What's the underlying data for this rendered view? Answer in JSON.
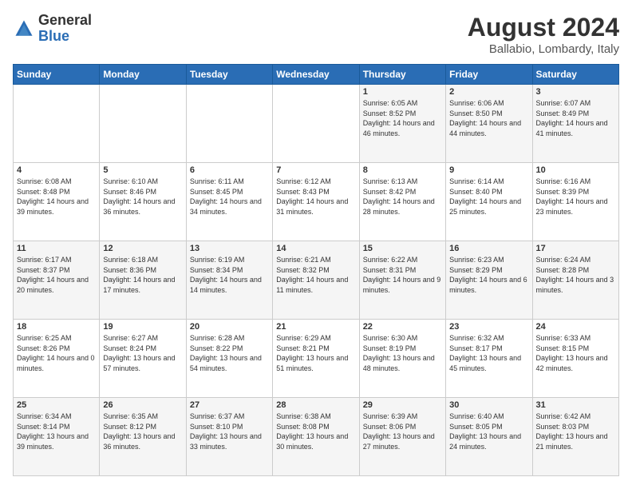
{
  "header": {
    "logo_general": "General",
    "logo_blue": "Blue",
    "main_title": "August 2024",
    "subtitle": "Ballabio, Lombardy, Italy"
  },
  "calendar": {
    "days_of_week": [
      "Sunday",
      "Monday",
      "Tuesday",
      "Wednesday",
      "Thursday",
      "Friday",
      "Saturday"
    ],
    "weeks": [
      [
        {
          "day": "",
          "info": ""
        },
        {
          "day": "",
          "info": ""
        },
        {
          "day": "",
          "info": ""
        },
        {
          "day": "",
          "info": ""
        },
        {
          "day": "1",
          "info": "Sunrise: 6:05 AM\nSunset: 8:52 PM\nDaylight: 14 hours and 46 minutes."
        },
        {
          "day": "2",
          "info": "Sunrise: 6:06 AM\nSunset: 8:50 PM\nDaylight: 14 hours and 44 minutes."
        },
        {
          "day": "3",
          "info": "Sunrise: 6:07 AM\nSunset: 8:49 PM\nDaylight: 14 hours and 41 minutes."
        }
      ],
      [
        {
          "day": "4",
          "info": "Sunrise: 6:08 AM\nSunset: 8:48 PM\nDaylight: 14 hours and 39 minutes."
        },
        {
          "day": "5",
          "info": "Sunrise: 6:10 AM\nSunset: 8:46 PM\nDaylight: 14 hours and 36 minutes."
        },
        {
          "day": "6",
          "info": "Sunrise: 6:11 AM\nSunset: 8:45 PM\nDaylight: 14 hours and 34 minutes."
        },
        {
          "day": "7",
          "info": "Sunrise: 6:12 AM\nSunset: 8:43 PM\nDaylight: 14 hours and 31 minutes."
        },
        {
          "day": "8",
          "info": "Sunrise: 6:13 AM\nSunset: 8:42 PM\nDaylight: 14 hours and 28 minutes."
        },
        {
          "day": "9",
          "info": "Sunrise: 6:14 AM\nSunset: 8:40 PM\nDaylight: 14 hours and 25 minutes."
        },
        {
          "day": "10",
          "info": "Sunrise: 6:16 AM\nSunset: 8:39 PM\nDaylight: 14 hours and 23 minutes."
        }
      ],
      [
        {
          "day": "11",
          "info": "Sunrise: 6:17 AM\nSunset: 8:37 PM\nDaylight: 14 hours and 20 minutes."
        },
        {
          "day": "12",
          "info": "Sunrise: 6:18 AM\nSunset: 8:36 PM\nDaylight: 14 hours and 17 minutes."
        },
        {
          "day": "13",
          "info": "Sunrise: 6:19 AM\nSunset: 8:34 PM\nDaylight: 14 hours and 14 minutes."
        },
        {
          "day": "14",
          "info": "Sunrise: 6:21 AM\nSunset: 8:32 PM\nDaylight: 14 hours and 11 minutes."
        },
        {
          "day": "15",
          "info": "Sunrise: 6:22 AM\nSunset: 8:31 PM\nDaylight: 14 hours and 9 minutes."
        },
        {
          "day": "16",
          "info": "Sunrise: 6:23 AM\nSunset: 8:29 PM\nDaylight: 14 hours and 6 minutes."
        },
        {
          "day": "17",
          "info": "Sunrise: 6:24 AM\nSunset: 8:28 PM\nDaylight: 14 hours and 3 minutes."
        }
      ],
      [
        {
          "day": "18",
          "info": "Sunrise: 6:25 AM\nSunset: 8:26 PM\nDaylight: 14 hours and 0 minutes."
        },
        {
          "day": "19",
          "info": "Sunrise: 6:27 AM\nSunset: 8:24 PM\nDaylight: 13 hours and 57 minutes."
        },
        {
          "day": "20",
          "info": "Sunrise: 6:28 AM\nSunset: 8:22 PM\nDaylight: 13 hours and 54 minutes."
        },
        {
          "day": "21",
          "info": "Sunrise: 6:29 AM\nSunset: 8:21 PM\nDaylight: 13 hours and 51 minutes."
        },
        {
          "day": "22",
          "info": "Sunrise: 6:30 AM\nSunset: 8:19 PM\nDaylight: 13 hours and 48 minutes."
        },
        {
          "day": "23",
          "info": "Sunrise: 6:32 AM\nSunset: 8:17 PM\nDaylight: 13 hours and 45 minutes."
        },
        {
          "day": "24",
          "info": "Sunrise: 6:33 AM\nSunset: 8:15 PM\nDaylight: 13 hours and 42 minutes."
        }
      ],
      [
        {
          "day": "25",
          "info": "Sunrise: 6:34 AM\nSunset: 8:14 PM\nDaylight: 13 hours and 39 minutes."
        },
        {
          "day": "26",
          "info": "Sunrise: 6:35 AM\nSunset: 8:12 PM\nDaylight: 13 hours and 36 minutes."
        },
        {
          "day": "27",
          "info": "Sunrise: 6:37 AM\nSunset: 8:10 PM\nDaylight: 13 hours and 33 minutes."
        },
        {
          "day": "28",
          "info": "Sunrise: 6:38 AM\nSunset: 8:08 PM\nDaylight: 13 hours and 30 minutes."
        },
        {
          "day": "29",
          "info": "Sunrise: 6:39 AM\nSunset: 8:06 PM\nDaylight: 13 hours and 27 minutes."
        },
        {
          "day": "30",
          "info": "Sunrise: 6:40 AM\nSunset: 8:05 PM\nDaylight: 13 hours and 24 minutes."
        },
        {
          "day": "31",
          "info": "Sunrise: 6:42 AM\nSunset: 8:03 PM\nDaylight: 13 hours and 21 minutes."
        }
      ]
    ]
  }
}
